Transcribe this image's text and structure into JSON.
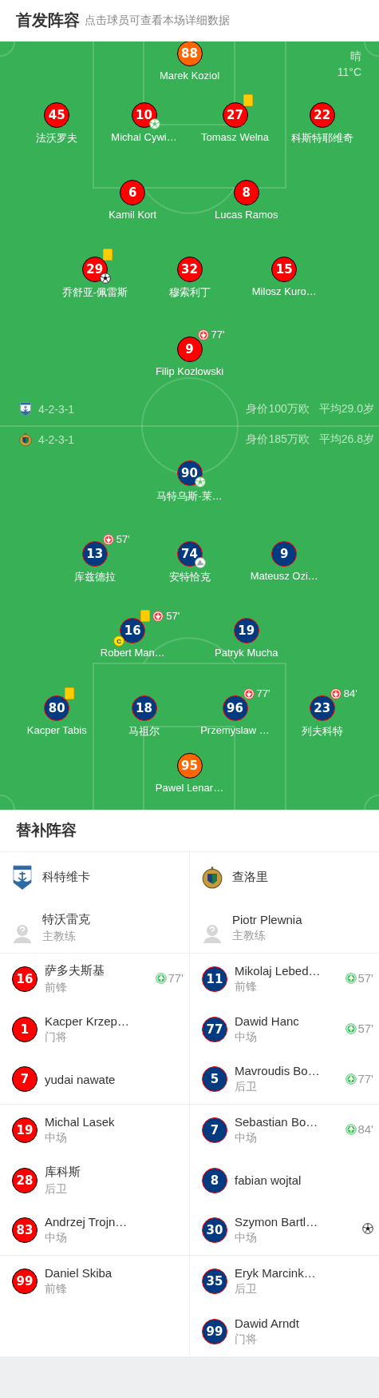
{
  "header": {
    "title": "首发阵容",
    "hint": "点击球员可查看本场详细数据"
  },
  "weather": {
    "condition": "晴",
    "temperature": "11°C"
  },
  "teams": [
    {
      "kind": "home",
      "color": "#ff0000",
      "formation": "4-2-3-1",
      "value": "身价100万欧",
      "age": "平均29.0岁",
      "lines": [
        {
          "kind": "goalkeeper",
          "players": [
            {
              "number": "88",
              "name": "Marek Koziol"
            }
          ]
        },
        {
          "kind": "outfield",
          "players": [
            {
              "number": "45",
              "name": "法沃罗夫"
            },
            {
              "number": "10",
              "name": "Michal Cywi…",
              "events": [
                {
                  "kind": "goal_light"
                }
              ]
            },
            {
              "number": "27",
              "name": "Tomasz Welna",
              "events": [
                {
                  "kind": "yellow_card"
                }
              ]
            },
            {
              "number": "22",
              "name": "科斯特耶维奇"
            }
          ]
        },
        {
          "kind": "outfield",
          "players": [
            {
              "number": "6",
              "name": "Kamil Kort"
            },
            {
              "number": "8",
              "name": "Lucas Ramos"
            }
          ]
        },
        {
          "kind": "outfield",
          "players": [
            {
              "number": "29",
              "name": "乔舒亚-佩雷斯",
              "events": [
                {
                  "kind": "yellow_card"
                },
                {
                  "kind": "goal"
                }
              ]
            },
            {
              "number": "32",
              "name": "穆索利丁"
            },
            {
              "number": "15",
              "name": "Milosz Kuro…"
            }
          ]
        },
        {
          "kind": "outfield",
          "players": [
            {
              "number": "9",
              "name": "Filip Kozlowski",
              "events": [
                {
                  "kind": "sub_out",
                  "minute": "77'"
                }
              ]
            }
          ]
        }
      ]
    },
    {
      "kind": "away",
      "color": "#003a80",
      "formation": "4-2-3-1",
      "value": "身价185万欧",
      "age": "平均26.8岁",
      "lines": [
        {
          "kind": "outfield",
          "players": [
            {
              "number": "90",
              "name": "马特乌斯-莱…",
              "events": [
                {
                  "kind": "goal_light"
                }
              ]
            }
          ]
        },
        {
          "kind": "outfield",
          "players": [
            {
              "number": "13",
              "name": "库兹德拉",
              "events": [
                {
                  "kind": "sub_out",
                  "minute": "57'"
                }
              ]
            },
            {
              "number": "74",
              "name": "安特恰克",
              "events": [
                {
                  "kind": "assist"
                }
              ]
            },
            {
              "number": "9",
              "name": "Mateusz Ozi…"
            }
          ]
        },
        {
          "kind": "outfield",
          "players": [
            {
              "number": "16",
              "name": "Robert Man…",
              "events": [
                {
                  "kind": "yellow_card"
                },
                {
                  "kind": "sub_out",
                  "minute": "57'"
                },
                {
                  "kind": "captain",
                  "label": "C"
                }
              ]
            },
            {
              "number": "19",
              "name": "Patryk Mucha"
            }
          ]
        },
        {
          "kind": "outfield",
          "players": [
            {
              "number": "80",
              "name": "Kacper Tabis",
              "events": [
                {
                  "kind": "yellow_card"
                }
              ]
            },
            {
              "number": "18",
              "name": "马祖尔"
            },
            {
              "number": "96",
              "name": "Przemyslaw …",
              "events": [
                {
                  "kind": "sub_out",
                  "minute": "77'"
                }
              ]
            },
            {
              "number": "23",
              "name": "列夫科特",
              "events": [
                {
                  "kind": "sub_out",
                  "minute": "84'"
                }
              ]
            }
          ]
        },
        {
          "kind": "goalkeeper",
          "players": [
            {
              "number": "95",
              "name": "Pawel Lenar…"
            }
          ]
        }
      ]
    }
  ],
  "bench": {
    "title": "替补阵容",
    "teams": [
      {
        "name": "科特维卡",
        "coach": "特沃雷克",
        "coach_role": "主教练",
        "players": [
          {
            "number": "16",
            "name": "萨多夫斯基",
            "position": "前锋",
            "event": {
              "kind": "sub_in",
              "minute": "77'"
            }
          },
          {
            "number": "1",
            "name": "Kacper Krzep…",
            "position": "门将"
          },
          {
            "number": "7",
            "name": "yudai nawate"
          },
          {
            "number": "19",
            "name": "Michal Lasek",
            "position": "中场"
          },
          {
            "number": "28",
            "name": "库科斯",
            "position": "后卫"
          },
          {
            "number": "83",
            "name": "Andrzej Trojn…",
            "position": "中场"
          },
          {
            "number": "99",
            "name": "Daniel Skiba",
            "position": "前锋"
          }
        ]
      },
      {
        "name": "查洛里",
        "coach": "Piotr Plewnia",
        "coach_role": "主教练",
        "players": [
          {
            "number": "11",
            "name": "Mikolaj Lebed…",
            "position": "前锋",
            "event": {
              "kind": "sub_in",
              "minute": "57'"
            }
          },
          {
            "number": "77",
            "name": "Dawid Hanc",
            "position": "中场",
            "event": {
              "kind": "sub_in",
              "minute": "57'"
            }
          },
          {
            "number": "5",
            "name": "Mavroudis Bo…",
            "position": "后卫",
            "event": {
              "kind": "sub_in",
              "minute": "77'"
            }
          },
          {
            "number": "7",
            "name": "Sebastian Bo…",
            "position": "中场",
            "event": {
              "kind": "sub_in",
              "minute": "84'"
            }
          },
          {
            "number": "8",
            "name": "fabian wojtal"
          },
          {
            "number": "30",
            "name": "Szymon Bartl…",
            "position": "中场",
            "event": {
              "kind": "goal"
            }
          },
          {
            "number": "35",
            "name": "Eryk Marcink…",
            "position": "后卫"
          },
          {
            "number": "99",
            "name": "Dawid Arndt",
            "position": "门将"
          }
        ]
      }
    ]
  }
}
